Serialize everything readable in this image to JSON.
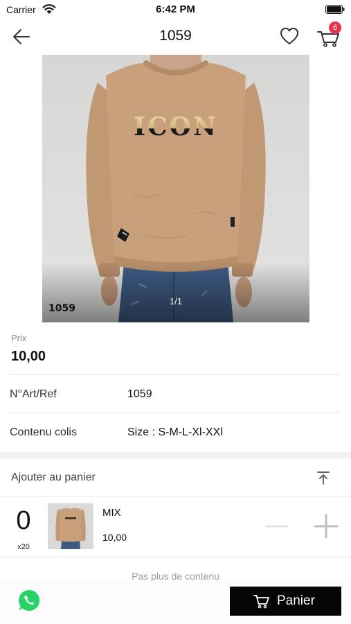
{
  "status_bar": {
    "carrier": "Carrier",
    "time": "6:42 PM",
    "icons": [
      "wifi-icon",
      "battery-icon"
    ]
  },
  "nav": {
    "title": "1059",
    "cart_count": "6",
    "icons": [
      "back-arrow-icon",
      "heart-icon",
      "cart-icon"
    ]
  },
  "product_image": {
    "print_text": "ICON",
    "overlay_ref": "1059",
    "counter": "1/1"
  },
  "details": {
    "price_label": "Prix",
    "price_value": "10,00",
    "rows": [
      {
        "label": "N°Art/Ref",
        "value": "1059"
      },
      {
        "label": "Contenu colis",
        "value": "Size : S-M-L-Xl-XXl"
      }
    ]
  },
  "add_to_cart": {
    "title": "Ajouter au panier",
    "quantity": "0",
    "pack": "x20",
    "variant_name": "MIX",
    "variant_price": "10,00"
  },
  "end_of_content": "Pas plus de contenu",
  "bottom_bar": {
    "cart_button_label": "Panier",
    "icons": [
      "whatsapp-icon",
      "cart-icon"
    ]
  },
  "colors": {
    "badge": "#e8334a",
    "cta_background": "#050505",
    "whatsapp": "#25d366",
    "sweater": "#c9a07c"
  }
}
